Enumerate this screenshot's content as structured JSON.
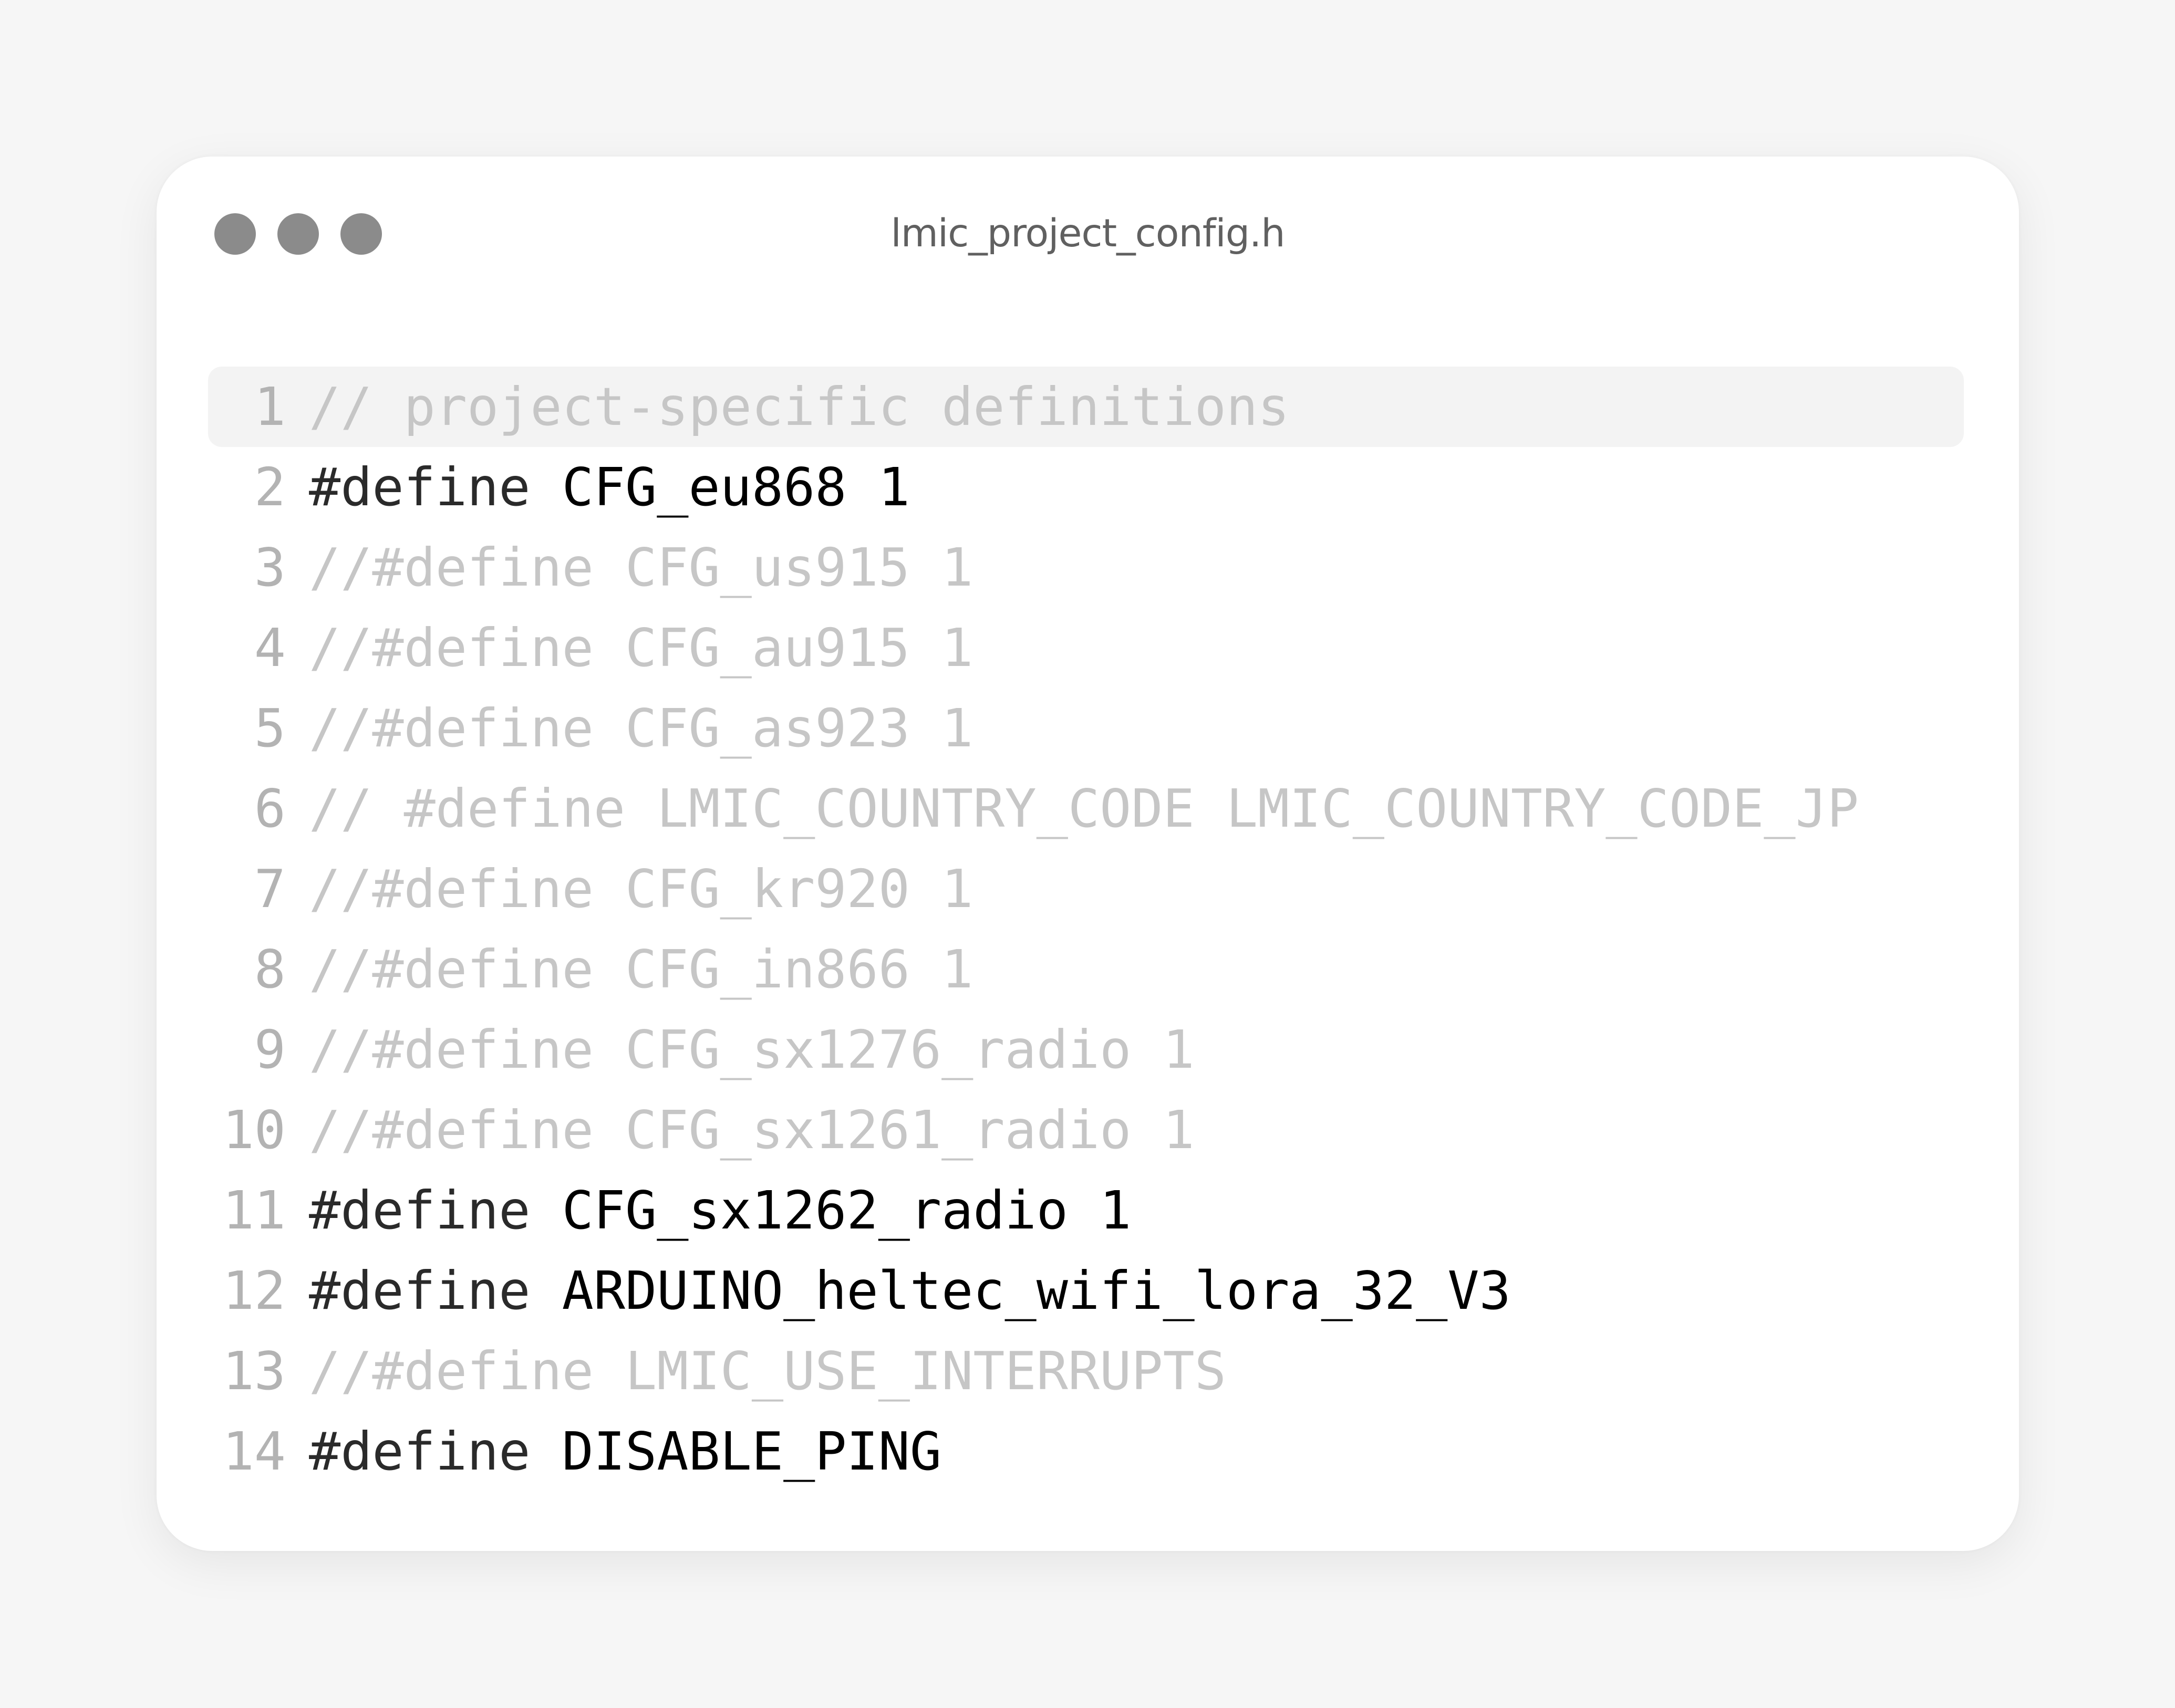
{
  "window": {
    "title": "lmic_project_config.h",
    "colors": {
      "background": "#f6f6f6",
      "card": "#ffffff",
      "traffic_dot": "#8b8b8b",
      "comment": "#c6c6c6",
      "code": "#000000",
      "line_number": "#b3b3b3",
      "active_line": "#f3f3f3"
    }
  },
  "editor": {
    "lines": [
      {
        "num": "1",
        "kind": "comment",
        "text": "// project-specific definitions",
        "active": true
      },
      {
        "num": "2",
        "kind": "define",
        "keyword": "#define",
        "rest": " CFG_eu868 1"
      },
      {
        "num": "3",
        "kind": "comment",
        "text": "//#define CFG_us915 1"
      },
      {
        "num": "4",
        "kind": "comment",
        "text": "//#define CFG_au915 1"
      },
      {
        "num": "5",
        "kind": "comment",
        "text": "//#define CFG_as923 1"
      },
      {
        "num": "6",
        "kind": "comment",
        "text": "// #define LMIC_COUNTRY_CODE LMIC_COUNTRY_CODE_JP"
      },
      {
        "num": "7",
        "kind": "comment",
        "text": "//#define CFG_kr920 1"
      },
      {
        "num": "8",
        "kind": "comment",
        "text": "//#define CFG_in866 1"
      },
      {
        "num": "9",
        "kind": "comment",
        "text": "//#define CFG_sx1276_radio 1"
      },
      {
        "num": "10",
        "kind": "comment",
        "text": "//#define CFG_sx1261_radio 1"
      },
      {
        "num": "11",
        "kind": "define",
        "keyword": "#define",
        "rest": " CFG_sx1262_radio 1"
      },
      {
        "num": "12",
        "kind": "define",
        "keyword": "#define",
        "rest": " ARDUINO_heltec_wifi_lora_32_V3"
      },
      {
        "num": "13",
        "kind": "comment",
        "text": "//#define LMIC_USE_INTERRUPTS"
      },
      {
        "num": "14",
        "kind": "define",
        "keyword": "#define",
        "rest": " DISABLE_PING"
      }
    ]
  }
}
